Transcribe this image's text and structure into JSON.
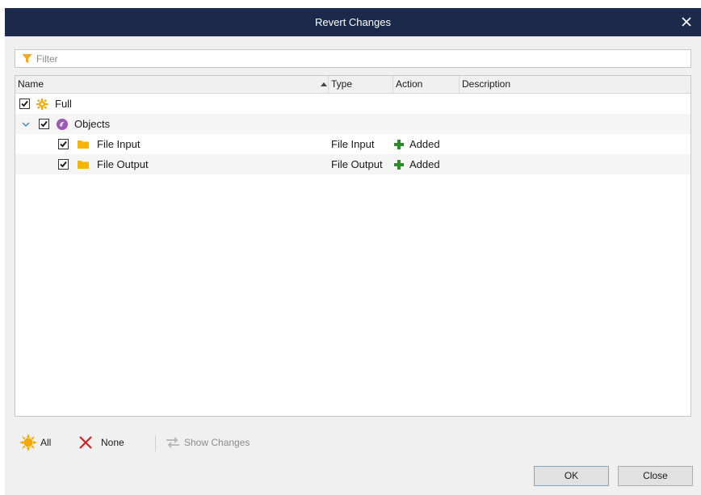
{
  "window": {
    "title": "Revert Changes"
  },
  "filter": {
    "placeholder": "Filter",
    "value": ""
  },
  "columns": [
    {
      "label": "Name",
      "sorted": "ascending"
    },
    {
      "label": "Type"
    },
    {
      "label": "Action"
    },
    {
      "label": "Description"
    }
  ],
  "rows": [
    {
      "name": "Full",
      "level": 0,
      "checked": true,
      "icon": "gear-sun-icon",
      "type": "",
      "action": "",
      "description": ""
    },
    {
      "name": "Objects",
      "level": 0,
      "checked": true,
      "expanded": true,
      "icon": "objects-icon",
      "type": "",
      "action": "",
      "description": ""
    },
    {
      "name": "File Input",
      "level": 1,
      "checked": true,
      "icon": "folder-icon",
      "type": "File Input",
      "action": "Added",
      "action_icon": "plus-icon",
      "description": ""
    },
    {
      "name": "File Output",
      "level": 1,
      "checked": true,
      "icon": "folder-icon",
      "type": "File Output",
      "action": "Added",
      "action_icon": "plus-icon",
      "description": ""
    }
  ],
  "toolbar": {
    "all_label": "All",
    "none_label": "None",
    "show_changes_label": "Show Changes"
  },
  "buttons": {
    "ok": "OK",
    "close": "Close"
  },
  "colors": {
    "titlebar": "#1b2a4a",
    "folder": "#f7b500",
    "added_plus": "#2e8b2e",
    "objects": "#9b59b6",
    "sun": "#f5a800",
    "none_x": "#d42020"
  }
}
